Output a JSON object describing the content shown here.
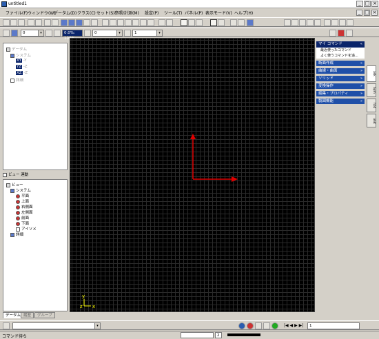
{
  "window": {
    "title": "untitled1"
  },
  "menu": [
    "ファイル(F)",
    "ウィンドウ(W)",
    "データム(D)",
    "クラス(C)",
    "セット(S)",
    "参照/計測(M)",
    "設定(P)",
    "ツール(T)",
    "パネル(P)",
    "表示モード(V)",
    "ヘルプ(H)"
  ],
  "toolbar2": {
    "combo1_value": "0",
    "combo2_value": "0.0%: 100%",
    "combo3_value": "0",
    "combo4_value": "1"
  },
  "datum_tree": {
    "root": "データム",
    "system": "システム",
    "planes": [
      "XY",
      "YZ",
      "XZ"
    ],
    "plane_suffix": [
      "-Y",
      "-Z",
      "-Z"
    ],
    "other": "詳細"
  },
  "view_panel": {
    "title": "ビュー 連動",
    "root": "ビュー",
    "system": "システム",
    "views": [
      "平面",
      "上面",
      "右側面",
      "左側面",
      "前面",
      "下面",
      "アイソメ"
    ],
    "other": "詳細"
  },
  "left_tabs": [
    "データム",
    "履歴",
    "グループ"
  ],
  "right_panel": {
    "header": "マイ コマンド",
    "sub_items": [
      "最近使ったコマンド",
      "よく使うコマンドを追..."
    ],
    "sections": [
      "断面作成",
      "曲線・曲面",
      "ソリッド",
      "変換操作",
      "編集・プロパティ",
      "製図機能"
    ]
  },
  "right_tabs": [
    "ask",
    "Sym",
    "fcld",
    "unit"
  ],
  "canvas": {
    "axis_x": "x",
    "axis_y": "y",
    "axis_z": "z"
  },
  "bottom_toolbar": {
    "page_value": "1"
  },
  "status": {
    "text": "コマンド待ち",
    "field1": "",
    "field2": "2"
  },
  "colors": {
    "axis_red": "#e00000",
    "axis_yellow": "#ffff00",
    "selection_blue": "#0a246a"
  }
}
